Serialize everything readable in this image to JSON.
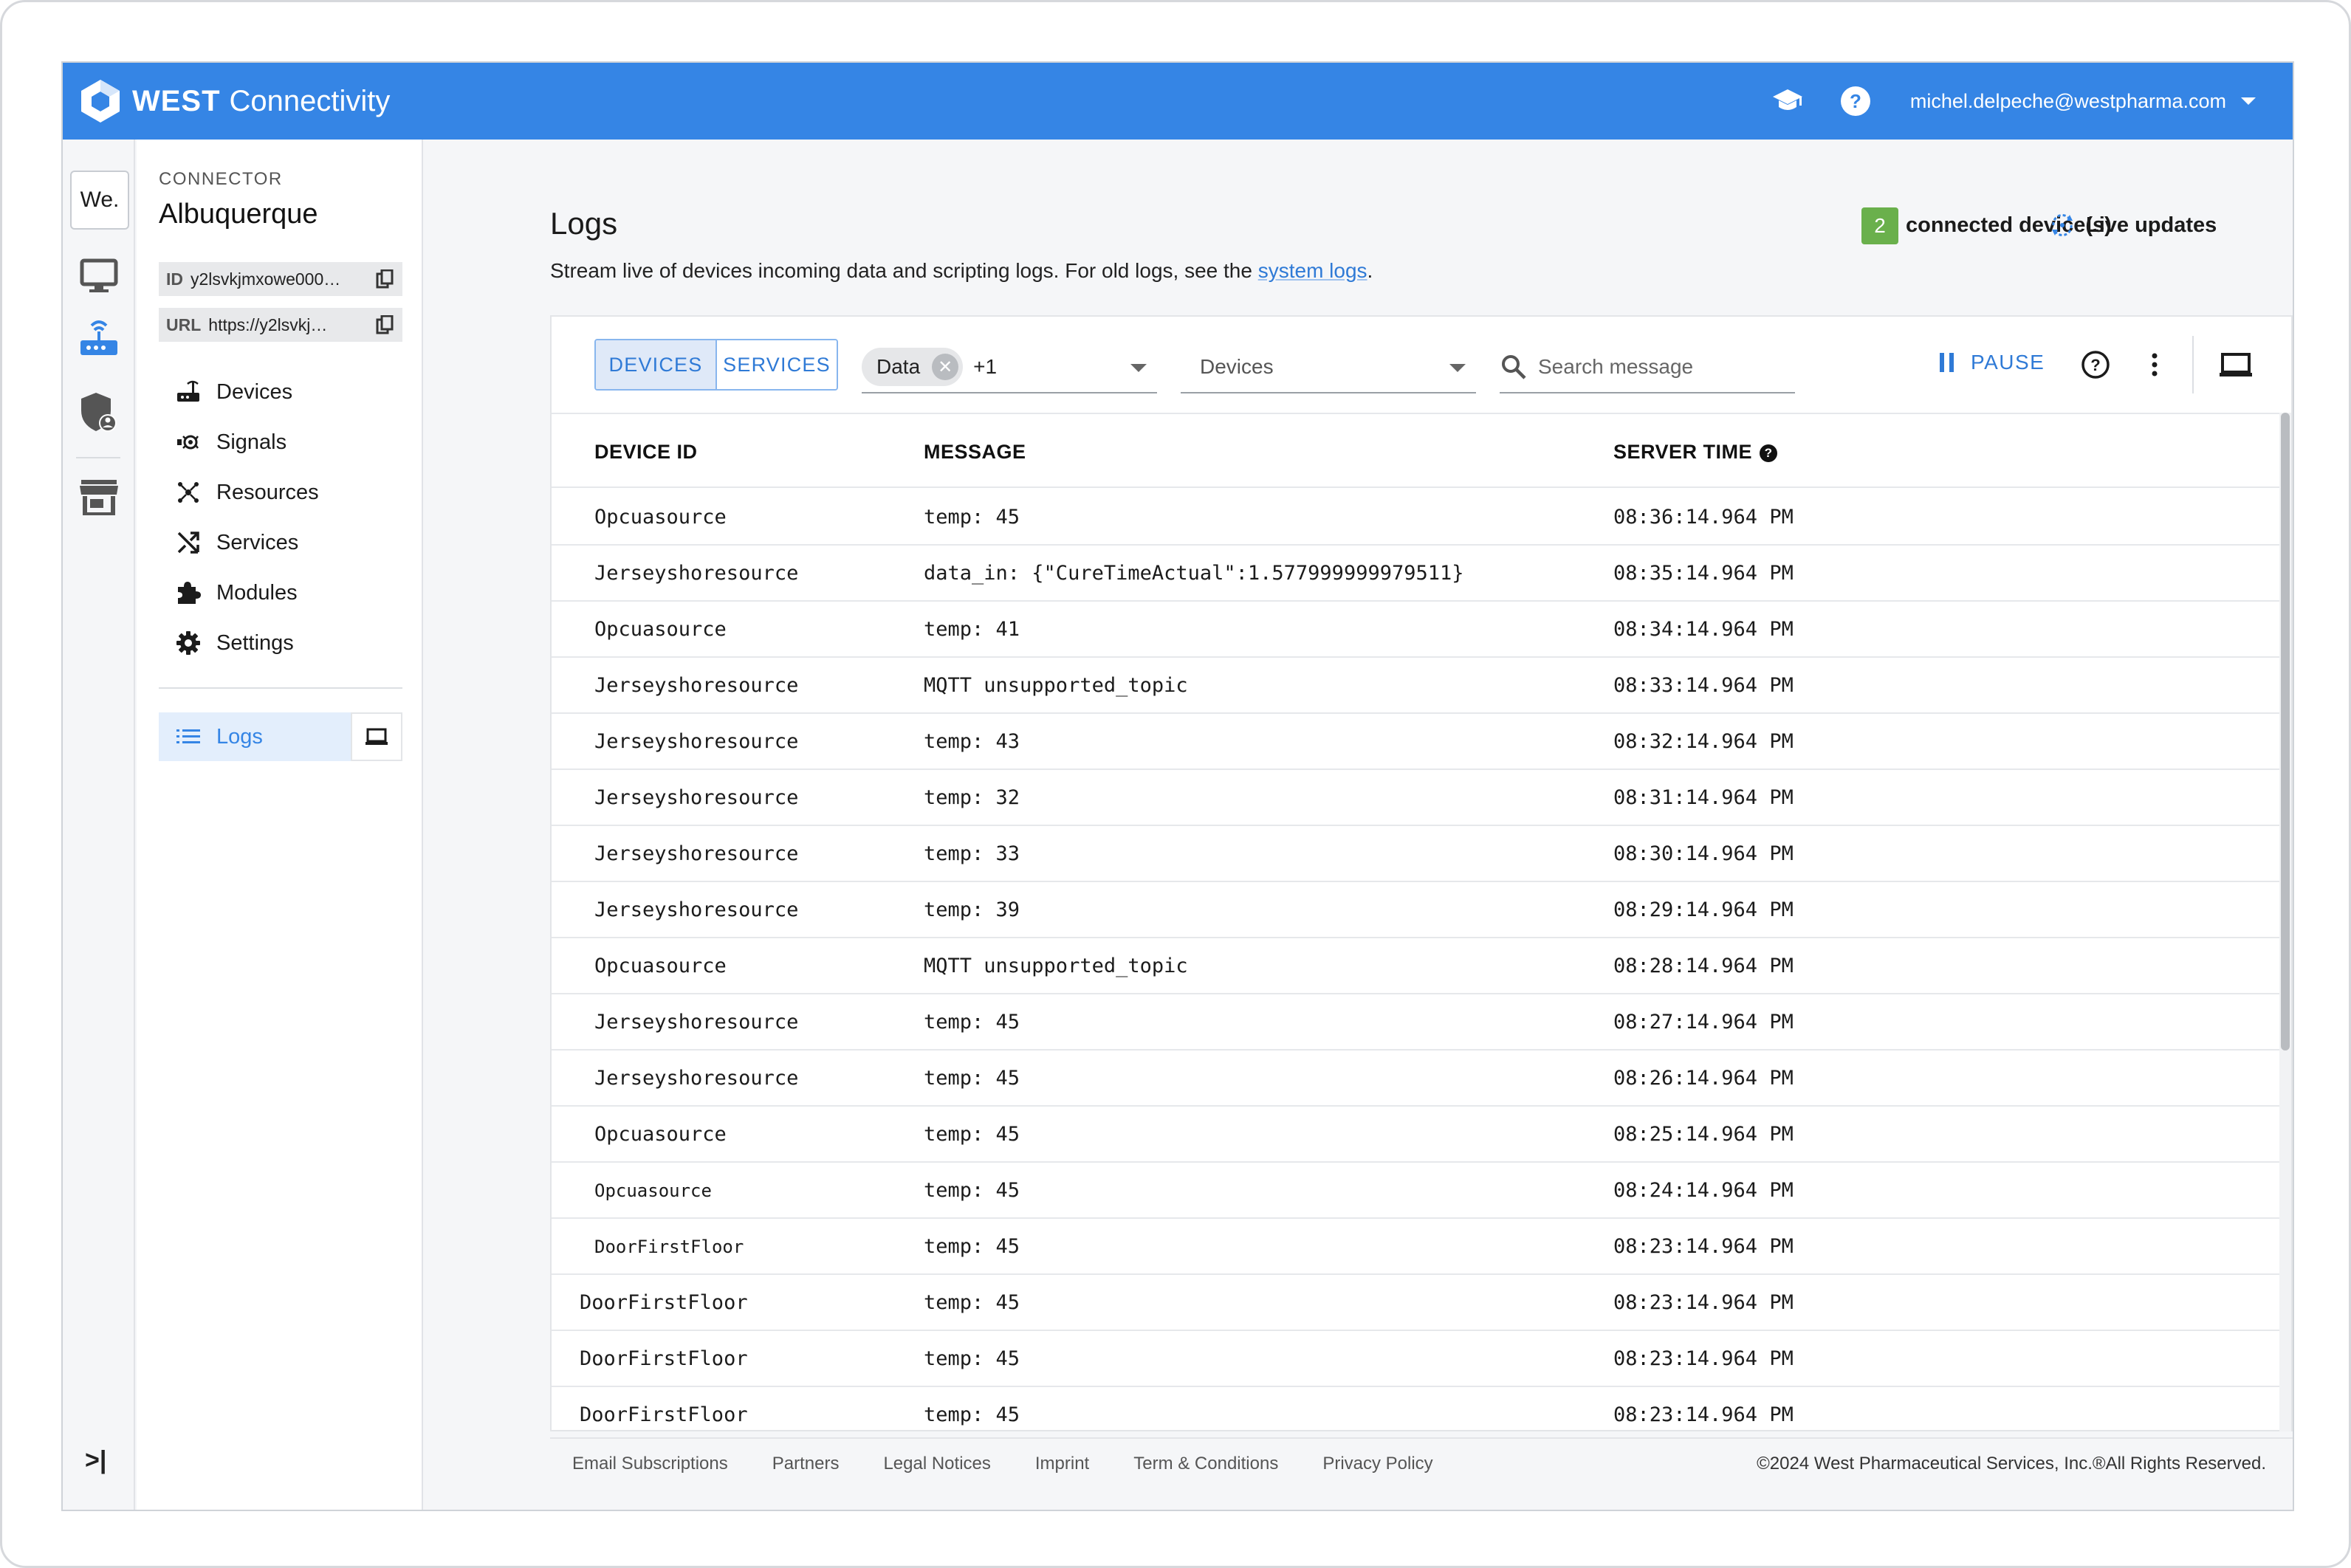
{
  "app": {
    "brand_strong": "WEST",
    "brand_light": "Connectivity",
    "user_email": "michel.delpeche@westpharma.com"
  },
  "rail": {
    "workspace_label": "We."
  },
  "connector": {
    "label": "CONNECTOR",
    "name": "Albuquerque",
    "id_key": "ID",
    "id_value": "y2lsvkjmxowe000…",
    "url_key": "URL",
    "url_value": "https://y2lsvkj…"
  },
  "nav": {
    "items": [
      {
        "label": "Devices",
        "icon": "router-icon"
      },
      {
        "label": "Signals",
        "icon": "signals-icon"
      },
      {
        "label": "Resources",
        "icon": "resources-icon"
      },
      {
        "label": "Services",
        "icon": "shuffle-icon"
      },
      {
        "label": "Modules",
        "icon": "puzzle-icon"
      },
      {
        "label": "Settings",
        "icon": "gear-icon"
      }
    ],
    "logs_label": "Logs"
  },
  "page": {
    "title": "Logs",
    "subtitle_prefix": "Stream live of devices incoming data and scripting logs. For old logs, see the ",
    "subtitle_link": "system logs",
    "subtitle_suffix": ".",
    "connected_count": "2",
    "connected_label": "connected device(s)",
    "live_label": "Live updates"
  },
  "toolbar": {
    "seg_devices": "DEVICES",
    "seg_services": "SERVICES",
    "chip_label": "Data",
    "chip_more": "+1",
    "devices_placeholder": "Devices",
    "search_placeholder": "Search message",
    "pause_label": "PAUSE"
  },
  "table": {
    "headers": [
      "DEVICE ID",
      "MESSAGE",
      "SERVER TIME"
    ],
    "rows": [
      {
        "device": "Opcuasource",
        "message": "temp: 45",
        "time": "08:36:14.964 PM"
      },
      {
        "device": "Jerseyshoresource",
        "message": "data_in: {\"CureTimeActual\":1.577999999979511}",
        "time": "08:35:14.964 PM"
      },
      {
        "device": "Opcuasource",
        "message": "temp: 41",
        "time": "08:34:14.964 PM"
      },
      {
        "device": "Jerseyshoresource",
        "message": "MQTT unsupported_topic",
        "time": "08:33:14.964 PM"
      },
      {
        "device": "Jerseyshoresource",
        "message": "temp: 43",
        "time": "08:32:14.964 PM"
      },
      {
        "device": "Jerseyshoresource",
        "message": "temp: 32",
        "time": "08:31:14.964 PM"
      },
      {
        "device": "Jerseyshoresource",
        "message": "temp: 33",
        "time": "08:30:14.964 PM"
      },
      {
        "device": "Jerseyshoresource",
        "message": "temp: 39",
        "time": "08:29:14.964 PM"
      },
      {
        "device": "Opcuasource",
        "message": "MQTT unsupported_topic",
        "time": "08:28:14.964 PM"
      },
      {
        "device": "Jerseyshoresource",
        "message": "temp: 45",
        "time": "08:27:14.964 PM"
      },
      {
        "device": "Jerseyshoresource",
        "message": "temp: 45",
        "time": "08:26:14.964 PM"
      },
      {
        "device": "Opcuasource",
        "message": "temp: 45",
        "time": "08:25:14.964 PM"
      },
      {
        "device": "Opcuasource",
        "message": "temp: 45",
        "time": "08:24:14.964 PM"
      },
      {
        "device": "DoorFirstFloor",
        "message": "temp: 45",
        "time": "08:23:14.964 PM"
      },
      {
        "device": "DoorFirstFloor",
        "message": "temp: 45",
        "time": "08:23:14.964 PM"
      },
      {
        "device": "DoorFirstFloor",
        "message": "temp: 45",
        "time": "08:23:14.964 PM"
      },
      {
        "device": "DoorFirstFloor",
        "message": "temp: 45",
        "time": "08:23:14.964 PM"
      }
    ]
  },
  "footer": {
    "links": [
      "Email Subscriptions",
      "Partners",
      "Legal Notices",
      "Imprint",
      "Term & Conditions",
      "Privacy Policy"
    ],
    "copyright": "©2024 West Pharmaceutical Services, Inc.®All Rights Reserved."
  },
  "colors": {
    "primary": "#3585e5",
    "badge_green": "#6ab04c",
    "link": "#2f7ad6"
  }
}
